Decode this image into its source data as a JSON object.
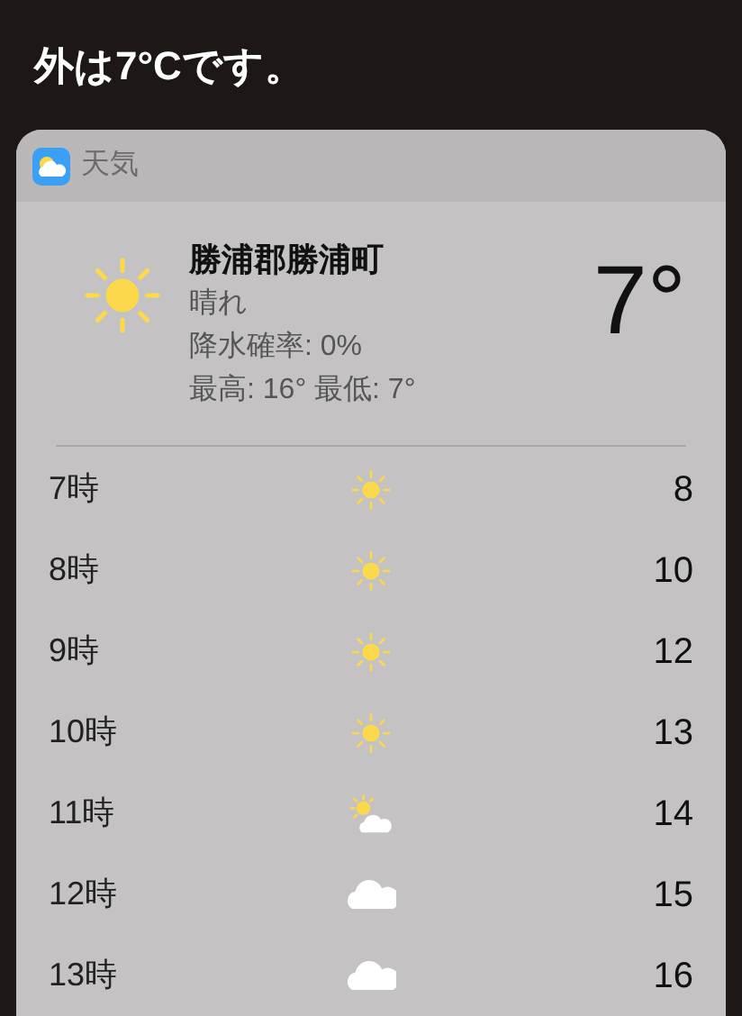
{
  "siri_response": "外は7°Cです。",
  "card": {
    "app_name": "天気",
    "current": {
      "kind": "sun",
      "location": "勝浦郡勝浦町",
      "condition": "晴れ",
      "precipitation": "降水確率: 0%",
      "high_low": "最高: 16° 最低: 7°",
      "temperature": "7°"
    },
    "hourly": [
      {
        "time": "7時",
        "kind": "sun",
        "temperature": "8"
      },
      {
        "time": "8時",
        "kind": "sun",
        "temperature": "10"
      },
      {
        "time": "9時",
        "kind": "sun",
        "temperature": "12"
      },
      {
        "time": "10時",
        "kind": "sun",
        "temperature": "13"
      },
      {
        "time": "11時",
        "kind": "partly",
        "temperature": "14"
      },
      {
        "time": "12時",
        "kind": "cloud",
        "temperature": "15"
      },
      {
        "time": "13時",
        "kind": "cloud",
        "temperature": "16"
      }
    ]
  }
}
